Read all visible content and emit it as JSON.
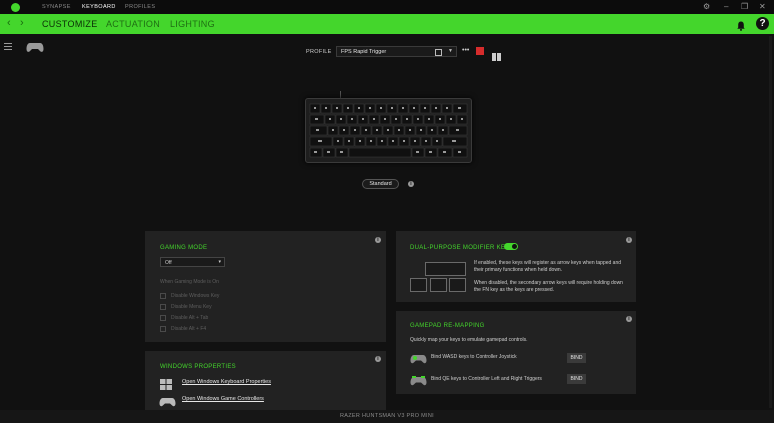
{
  "titlebar": {
    "tabs": [
      "SYNAPSE",
      "KEYBOARD",
      "PROFILES"
    ],
    "active_tab": "KEYBOARD",
    "controls": [
      "⚙",
      "–",
      "❐",
      "✕"
    ]
  },
  "subnav": {
    "tabs": [
      "CUSTOMIZE",
      "ACTUATION",
      "LIGHTING"
    ],
    "active_tab": "CUSTOMIZE",
    "help_label": "?"
  },
  "profile": {
    "label": "PROFILE",
    "value": "FPS Rapid Trigger",
    "more_label": "•••"
  },
  "device": {
    "mode_label": "Standard",
    "name": "RAZER HUNTSMAN V3 PRO MINI"
  },
  "gaming_mode": {
    "title": "GAMING MODE",
    "select_value": "Off",
    "helper": "When Gaming Mode is On",
    "options": [
      "Disable Windows Key",
      "Disable Menu Key",
      "Disable Alt + Tab",
      "Disable Alt + F4"
    ]
  },
  "dual_purpose": {
    "title": "DUAL-PURPOSE MODIFIER KEYS",
    "enabled": true,
    "desc_enabled": "If enabled, these keys will register as arrow keys when tapped and their primary functions when held down.",
    "desc_disabled": "When disabled, the secondary arrow keys will require holding down the FN key as the keys are pressed."
  },
  "gamepad": {
    "title": "GAMEPAD RE-MAPPING",
    "subtitle": "Quickly map your keys to emulate gamepad controls.",
    "rows": [
      {
        "label": "Bind WASD keys to Controller Joystick",
        "button": "BIND"
      },
      {
        "label": "Bind QE keys to Controller Left and Right Triggers",
        "button": "BIND"
      }
    ]
  },
  "windows_props": {
    "title": "WINDOWS PROPERTIES",
    "links": [
      "Open Windows Keyboard Properties",
      "Open Windows Game Controllers"
    ]
  },
  "colors": {
    "accent": "#44d62c",
    "panel": "#222222",
    "background": "#111111",
    "danger": "#d62c2c"
  },
  "icons": [
    "menu-icon",
    "gamepad-icon",
    "bell-icon",
    "help-icon",
    "windows-icon",
    "info-icon",
    "book-icon"
  ]
}
